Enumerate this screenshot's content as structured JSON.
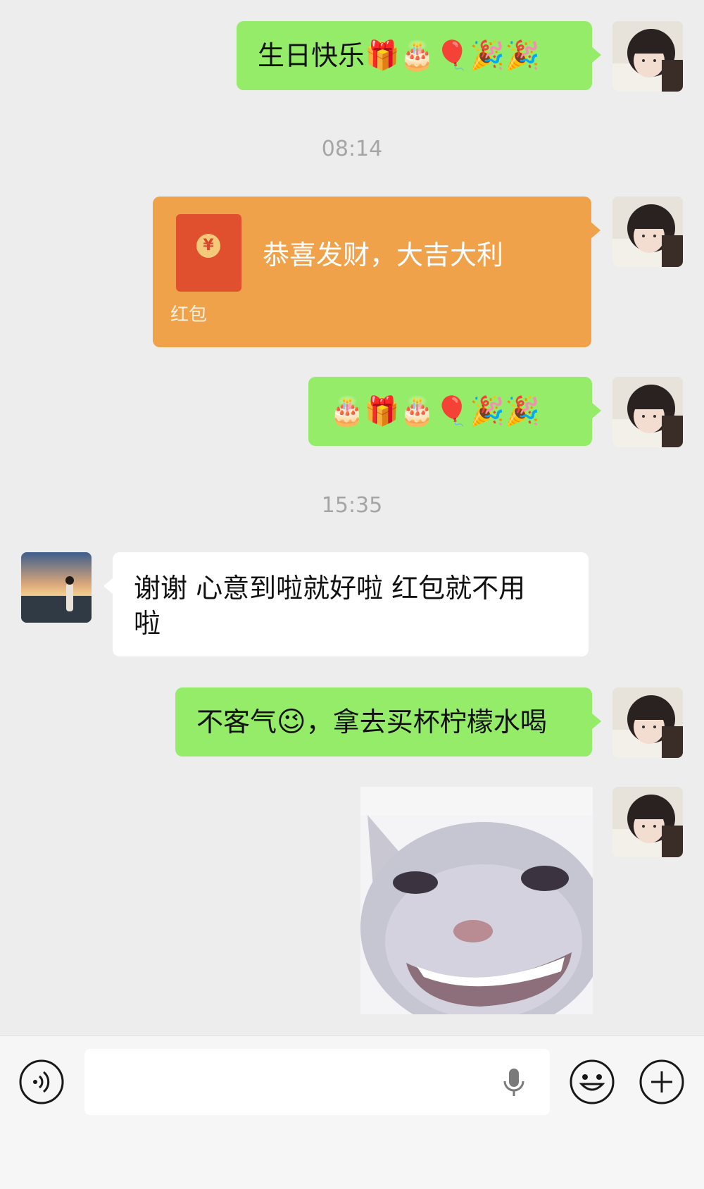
{
  "messages": {
    "m1": {
      "text": "生日快乐",
      "emojis": "🎁🎂🎈🎉🎉"
    },
    "t1": "08:14",
    "red_packet": {
      "title": "恭喜发财，大吉大利",
      "label": "红包",
      "coin": "¥"
    },
    "m3": {
      "emojis": "🎂🎁🎂🎈🎉🎉"
    },
    "t2": "15:35",
    "m4": {
      "line1": "谢谢   心意到啦就好啦   红包就不用",
      "line2": "啦"
    },
    "m5": {
      "text": "不客气",
      "emoji": "😉",
      "rest": "，拿去买杯柠檬水喝"
    }
  },
  "colors": {
    "background": "#ededed",
    "green_bubble": "#95ec69",
    "white_bubble": "#ffffff",
    "red_packet": "#f0a24b",
    "timestamp": "#a5a5a5"
  },
  "input_bar": {
    "placeholder": "",
    "icons": [
      "voice-icon",
      "microphone-icon",
      "emoji-icon",
      "plus-icon"
    ]
  }
}
